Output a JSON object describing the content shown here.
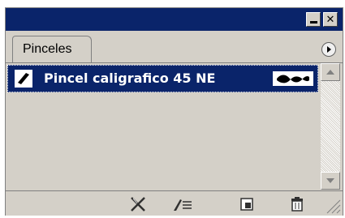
{
  "panel": {
    "tab_label": "Pinceles",
    "window_controls": {
      "minimize_icon": "minimize-icon",
      "close_icon": "close-icon",
      "close_glyph": "✕"
    }
  },
  "brushes": [
    {
      "name": "Pincel caligrafico 45 NE",
      "selected": true,
      "thumbnail_icon": "calligraphic-brush-icon",
      "preview_icon": "stroke-preview-icon"
    }
  ],
  "toolbar": {
    "icons": [
      "remove-brush-stroke-icon",
      "brush-options-icon",
      "new-brush-icon",
      "delete-brush-icon"
    ]
  },
  "colors": {
    "title_bar": "#0a246a",
    "selection": "#0a246a",
    "panel_bg": "#d4d0c8"
  }
}
